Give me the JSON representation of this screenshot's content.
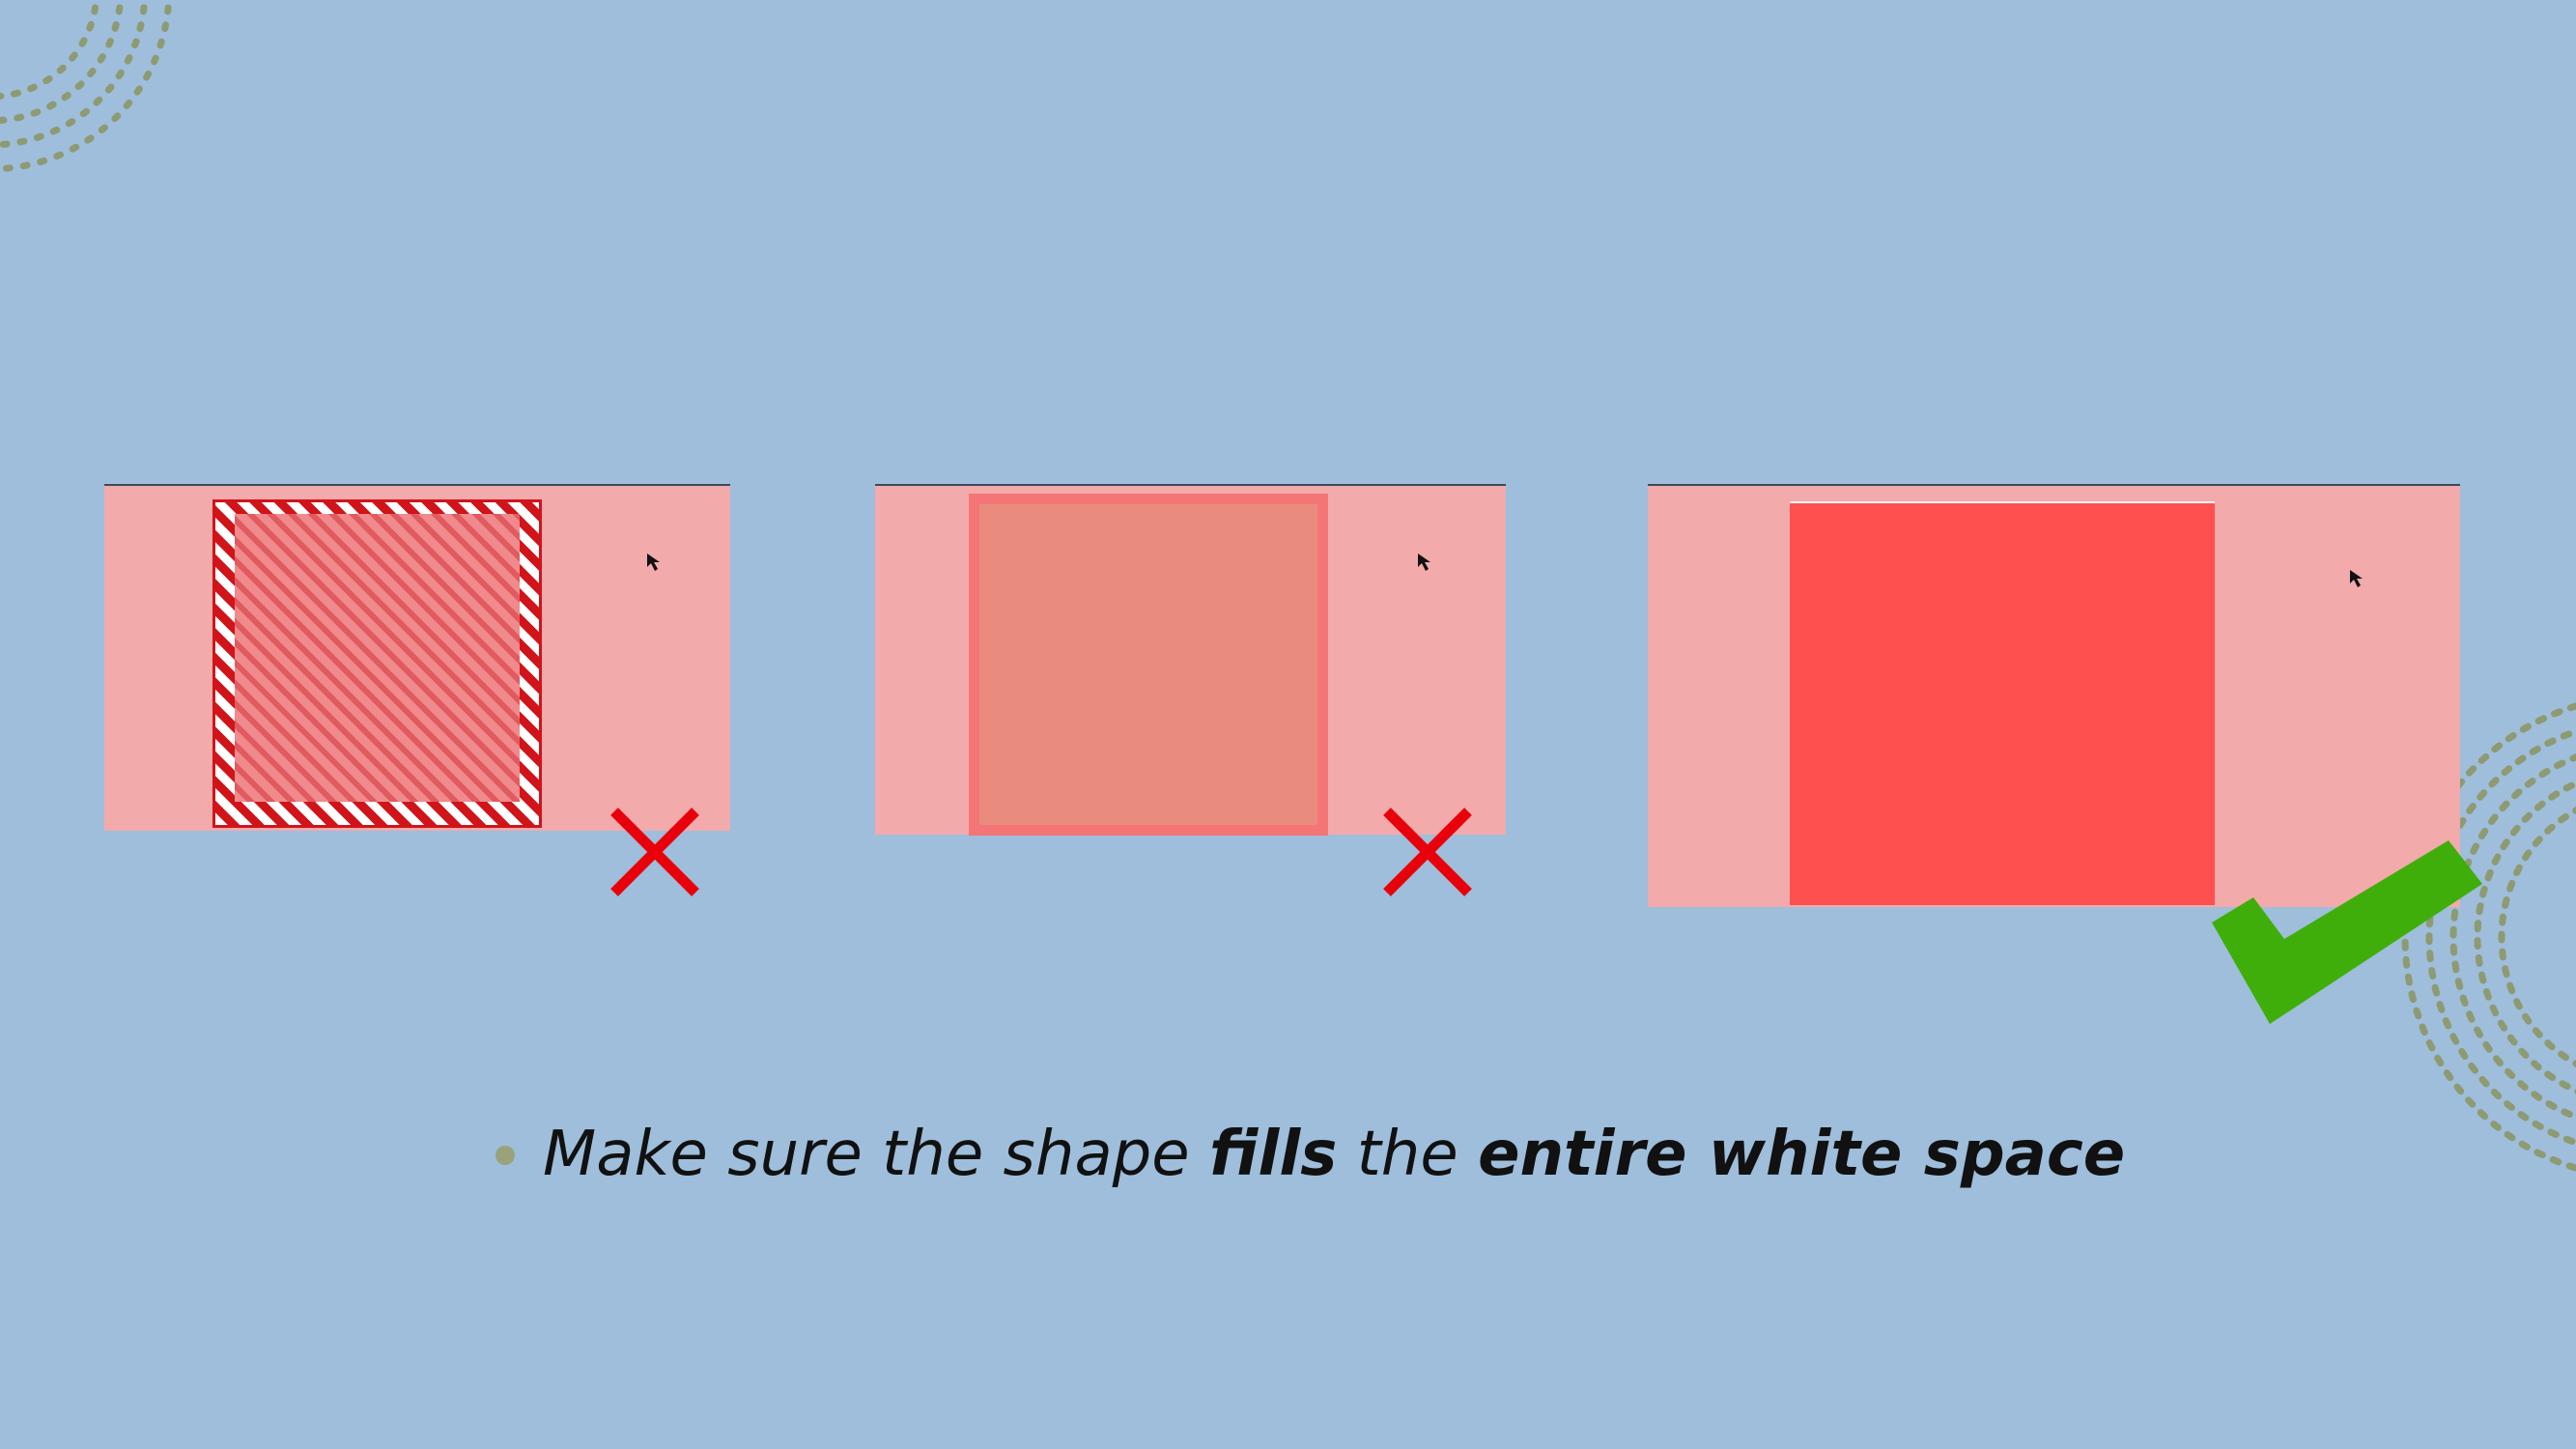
{
  "slide": {
    "background_color": "#9ebedb",
    "accent_color": "#9aa27c",
    "caption": {
      "bullet_icon": "bullet-dot-icon",
      "part1": "Make sure the shape ",
      "part2_bold": "fills",
      "part3": " the ",
      "part4_bold": "entire white space"
    },
    "examples": [
      {
        "id": "hatched",
        "verdict": "incorrect",
        "icon": "red-x-icon",
        "mark_color": "#e8000b"
      },
      {
        "id": "outlined",
        "verdict": "incorrect",
        "icon": "red-x-icon",
        "mark_color": "#e8000b"
      },
      {
        "id": "solid",
        "verdict": "correct",
        "icon": "green-check-icon",
        "mark_color": "#3fae0a"
      }
    ],
    "panel_color": "#f2aaab",
    "cursor_icon": "mouse-pointer-icon"
  }
}
